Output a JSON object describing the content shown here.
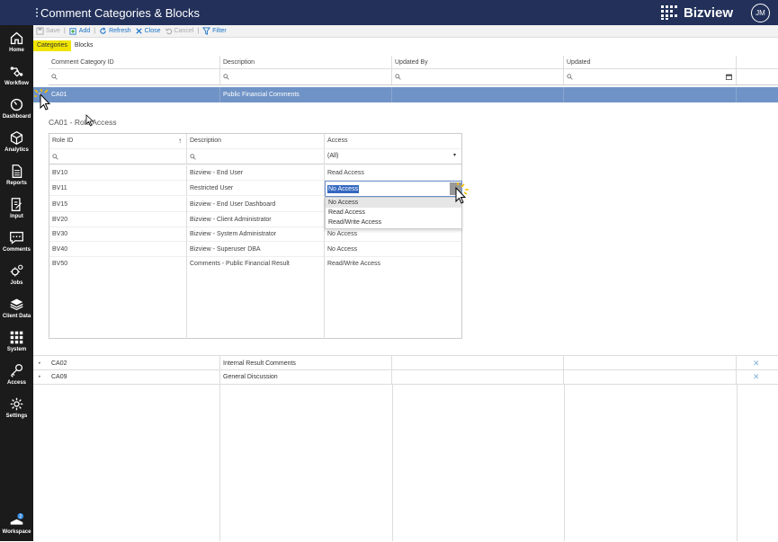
{
  "app": {
    "title": "Comment Categories & Blocks",
    "brand": "Bizview",
    "user_initials": "JM"
  },
  "sidebar": {
    "items": [
      {
        "label": "Home",
        "icon": "home-icon"
      },
      {
        "label": "Workflow",
        "icon": "workflow-icon"
      },
      {
        "label": "Dashboard",
        "icon": "dashboard-icon"
      },
      {
        "label": "Analytics",
        "icon": "analytics-icon"
      },
      {
        "label": "Reports",
        "icon": "reports-icon"
      },
      {
        "label": "Input",
        "icon": "input-icon"
      },
      {
        "label": "Comments",
        "icon": "comments-icon"
      },
      {
        "label": "Jobs",
        "icon": "jobs-icon"
      },
      {
        "label": "Client Data",
        "icon": "client-data-icon"
      },
      {
        "label": "System",
        "icon": "system-icon"
      },
      {
        "label": "Access",
        "icon": "access-icon"
      },
      {
        "label": "Settings",
        "icon": "settings-icon"
      }
    ],
    "workspace_label": "Workspace",
    "workspace_badge": "2"
  },
  "toolbar": {
    "save": "Save",
    "add": "Add",
    "refresh": "Refresh",
    "close": "Close",
    "cancel": "Cancel",
    "filter": "Filter"
  },
  "tabs": [
    "Categories",
    "Blocks"
  ],
  "grid": {
    "columns": [
      "Comment Category ID",
      "Description",
      "Updated By",
      "Updated"
    ],
    "rows": [
      {
        "id": "CA01",
        "description": "Public Financial Comments",
        "updated_by": "",
        "updated": ""
      },
      {
        "id": "CA02",
        "description": "Internal Result Comments",
        "updated_by": "",
        "updated": ""
      },
      {
        "id": "CA09",
        "description": "General Discussion",
        "updated_by": "",
        "updated": ""
      }
    ]
  },
  "subgrid": {
    "title": "CA01 - Role Access",
    "columns": [
      "Role ID",
      "Description",
      "Access"
    ],
    "access_filter": "(All)",
    "rows": [
      {
        "role": "BV10",
        "description": "Bizview - End User",
        "access": "Read Access"
      },
      {
        "role": "BV11",
        "description": "Restricted User",
        "access": "No Access"
      },
      {
        "role": "BV15",
        "description": "Bizview - End User Dashboard",
        "access": ""
      },
      {
        "role": "BV20",
        "description": "Bizview - Client Administrator",
        "access": ""
      },
      {
        "role": "BV30",
        "description": "Bizview - System Administrator",
        "access": "No Access"
      },
      {
        "role": "BV40",
        "description": "Bizview - Superuser DBA",
        "access": "No Access"
      },
      {
        "role": "BV50",
        "description": "Comments - Public Financial Result",
        "access": "Read/Write Access"
      }
    ],
    "dropdown_options": [
      "No Access",
      "Read Access",
      "Read/Write Access"
    ]
  },
  "colors": {
    "topbar": "#22305a",
    "sidebar": "#1b1b1b",
    "selected_row": "#6f93c6",
    "active_tab": "#f0e400",
    "link": "#1a73c8"
  }
}
